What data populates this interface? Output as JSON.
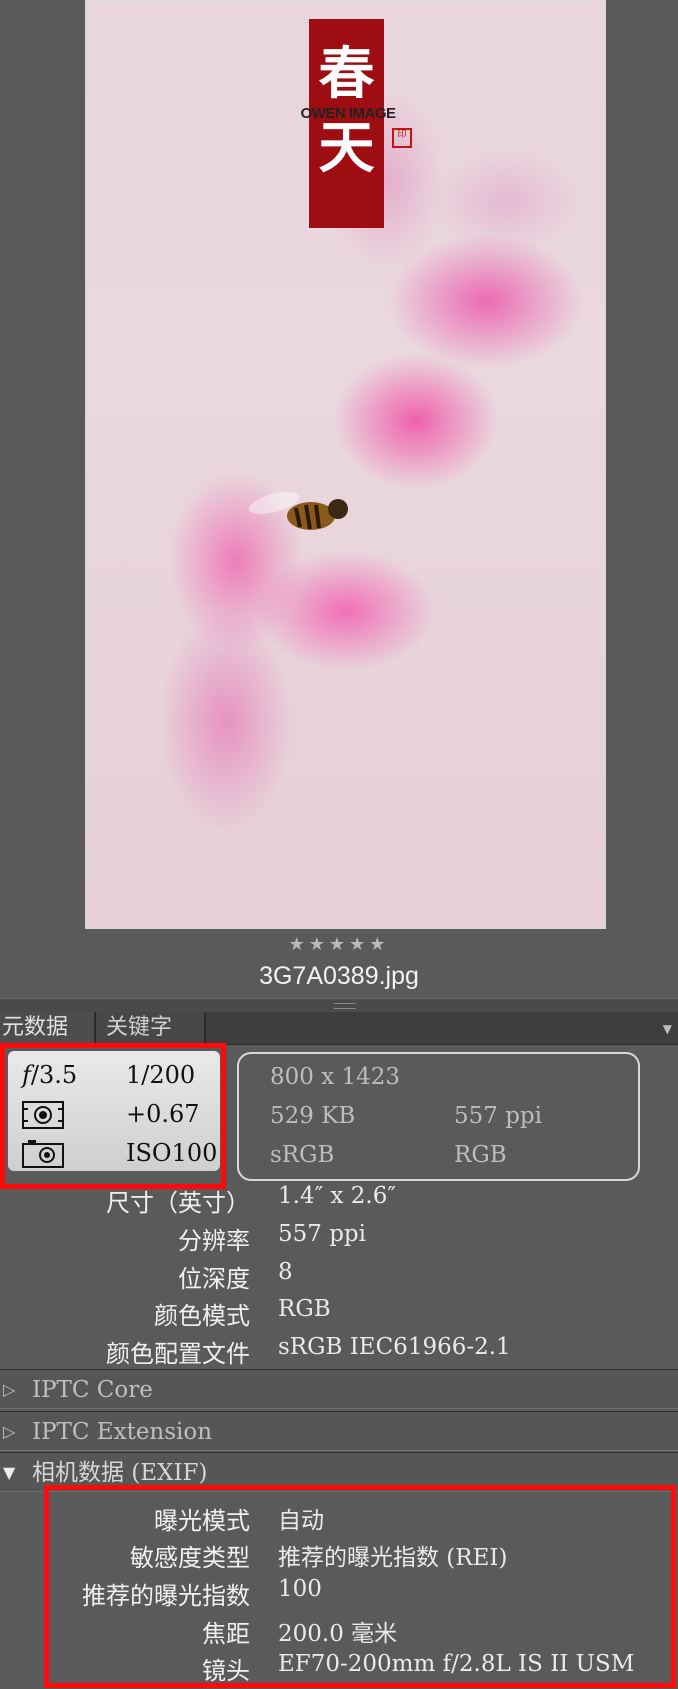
{
  "preview": {
    "calligraphy": "春天",
    "watermark": "OWEN IMAGE"
  },
  "rating": "★★★★★",
  "filename": "3G7A0389.jpg",
  "tabs": {
    "metadata": "元数据",
    "keywords": "关键字"
  },
  "exposure": {
    "fnumber": "𝑓/3.5",
    "shutter": "1/200",
    "ev": "+0.67",
    "iso": "ISO100"
  },
  "file_info": {
    "dimensions": "800 x 1423",
    "size": "529 KB",
    "ppi": "557 ppi",
    "profile": "sRGB",
    "mode": "RGB"
  },
  "file_props": [
    {
      "label": "尺寸（英寸）",
      "value": "1.4″ x 2.6″"
    },
    {
      "label": "分辨率",
      "value": "557 ppi"
    },
    {
      "label": "位深度",
      "value": "8"
    },
    {
      "label": "颜色模式",
      "value": "RGB"
    },
    {
      "label": "颜色配置文件",
      "value": "sRGB IEC61966-2.1"
    }
  ],
  "sections": {
    "iptc_core": "IPTC Core",
    "iptc_ext": "IPTC Extension",
    "exif": "相机数据 (EXIF)"
  },
  "exif_props": [
    {
      "label": "曝光模式",
      "value": "自动"
    },
    {
      "label": "敏感度类型",
      "value": "推荐的曝光指数 (REI)"
    },
    {
      "label": "推荐的曝光指数",
      "value": "100"
    },
    {
      "label": "焦距",
      "value": "200.0 毫米"
    },
    {
      "label": "镜头",
      "value": "EF70-200mm f/2.8L IS II USM"
    }
  ],
  "colors": {
    "highlight": "#ff0a0a",
    "calligraphy_bg": "#9e0d12"
  }
}
